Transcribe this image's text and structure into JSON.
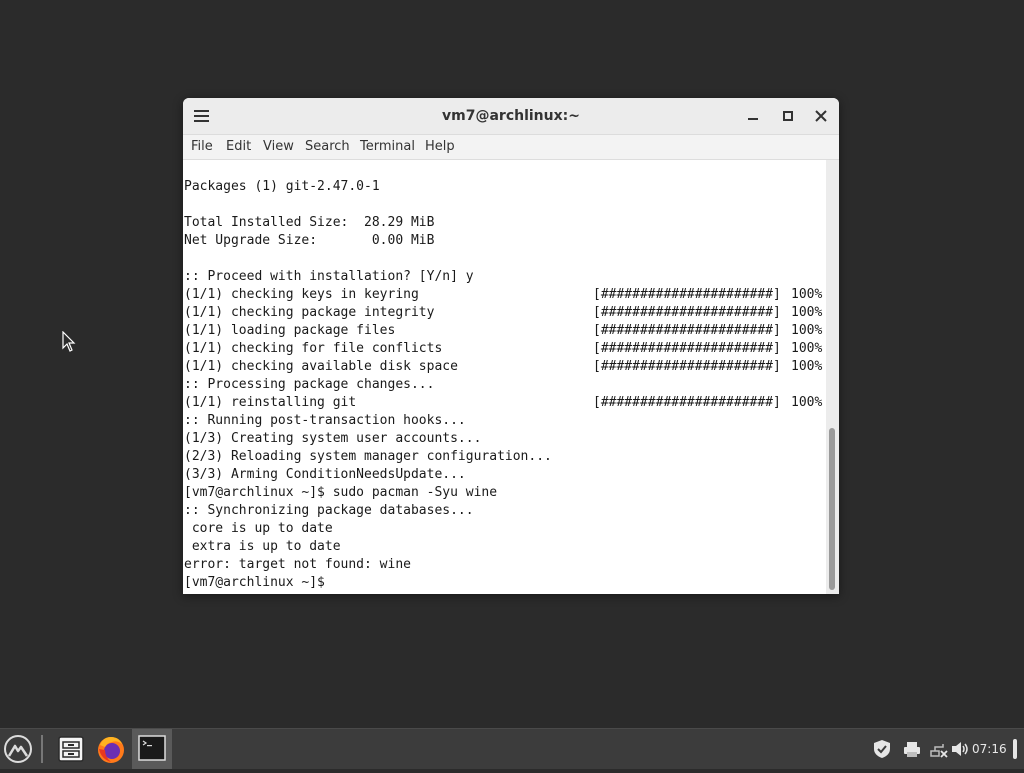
{
  "window": {
    "title": "vm7@archlinux:~",
    "menu": [
      "File",
      "Edit",
      "View",
      "Search",
      "Terminal",
      "Help"
    ]
  },
  "terminal": {
    "lines": [
      {
        "text": "Packages (1) git-2.47.0-1"
      },
      {
        "text": ""
      },
      {
        "text": "Total Installed Size:  28.29 MiB"
      },
      {
        "text": "Net Upgrade Size:       0.00 MiB"
      },
      {
        "text": ""
      },
      {
        "text": ":: Proceed with installation? [Y/n] y"
      },
      {
        "text": "(1/1) checking keys in keyring",
        "bar": "[######################]",
        "pct": "100%"
      },
      {
        "text": "(1/1) checking package integrity",
        "bar": "[######################]",
        "pct": "100%"
      },
      {
        "text": "(1/1) loading package files",
        "bar": "[######################]",
        "pct": "100%"
      },
      {
        "text": "(1/1) checking for file conflicts",
        "bar": "[######################]",
        "pct": "100%"
      },
      {
        "text": "(1/1) checking available disk space",
        "bar": "[######################]",
        "pct": "100%"
      },
      {
        "text": ":: Processing package changes..."
      },
      {
        "text": "(1/1) reinstalling git",
        "bar": "[######################]",
        "pct": "100%"
      },
      {
        "text": ":: Running post-transaction hooks..."
      },
      {
        "text": "(1/3) Creating system user accounts..."
      },
      {
        "text": "(2/3) Reloading system manager configuration..."
      },
      {
        "text": "(3/3) Arming ConditionNeedsUpdate..."
      },
      {
        "text": "[vm7@archlinux ~]$ sudo pacman -Syu wine"
      },
      {
        "text": ":: Synchronizing package databases..."
      },
      {
        "text": " core is up to date"
      },
      {
        "text": " extra is up to date"
      },
      {
        "text": "error: target not found: wine"
      },
      {
        "text": "[vm7@archlinux ~]$ "
      }
    ]
  },
  "taskbar": {
    "clock": "07:16",
    "launchers": [
      "app-menu-icon",
      "files-icon",
      "firefox-icon",
      "terminal-icon"
    ],
    "tray": [
      "shield-icon",
      "printer-icon",
      "network-icon",
      "volume-icon"
    ]
  },
  "colors": {
    "desktop": "#2b2b2b",
    "taskbar": "#3c3c3c",
    "titlebar": "#ececec",
    "terminal_bg": "#ffffff",
    "terminal_fg": "#1a1a1a"
  }
}
